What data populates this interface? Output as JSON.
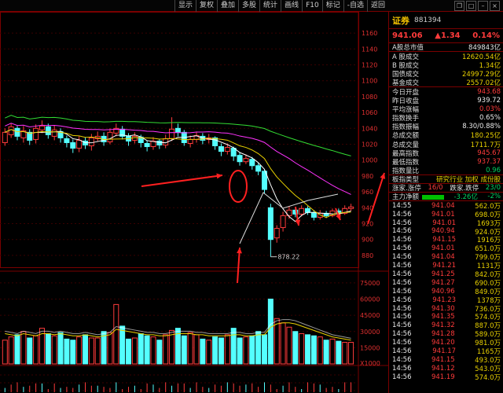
{
  "toolbar": [
    "显示",
    "复权",
    "叠加",
    "多股",
    "统计",
    "画线",
    "F10",
    "标记",
    "-自选",
    "返回"
  ],
  "window_controls": [
    "icon-r",
    "icon-max",
    "icon-min",
    "icon-x"
  ],
  "colors": {
    "up": "#ff3b3b",
    "down": "#54ffff",
    "ma1": "#ffffff",
    "ma2": "#e8d000",
    "ma3": "#ff33ff",
    "ma4": "#33dd33",
    "grid": "#7a0000"
  },
  "chart_data": {
    "type": "candlestick",
    "price_ticks": [
      "1160",
      "1140",
      "1120",
      "1100",
      "1080",
      "1060",
      "1040",
      "1020",
      "1000",
      "980",
      "960",
      "940",
      "920",
      "900",
      "880"
    ],
    "price_range": [
      870,
      1170
    ],
    "low_label": "878.22",
    "volume_ticks": [
      "75000",
      "60000",
      "45000",
      "30000",
      "15000",
      "X1000"
    ],
    "volume_range": [
      0,
      80000
    ],
    "candles": [
      {
        "o": 1022,
        "c": 1035,
        "h": 1040,
        "l": 1018
      },
      {
        "o": 1032,
        "c": 1042,
        "h": 1046,
        "l": 1028
      },
      {
        "o": 1040,
        "c": 1030,
        "h": 1043,
        "l": 1025
      },
      {
        "o": 1028,
        "c": 1037,
        "h": 1043,
        "l": 1022
      },
      {
        "o": 1035,
        "c": 1025,
        "h": 1039,
        "l": 1019
      },
      {
        "o": 1026,
        "c": 1040,
        "h": 1045,
        "l": 1021
      },
      {
        "o": 1038,
        "c": 1043,
        "h": 1050,
        "l": 1034
      },
      {
        "o": 1042,
        "c": 1032,
        "h": 1046,
        "l": 1027
      },
      {
        "o": 1030,
        "c": 1038,
        "h": 1044,
        "l": 1025
      },
      {
        "o": 1036,
        "c": 1028,
        "h": 1040,
        "l": 1022
      },
      {
        "o": 1027,
        "c": 1022,
        "h": 1031,
        "l": 1016
      },
      {
        "o": 1022,
        "c": 1015,
        "h": 1026,
        "l": 1009
      },
      {
        "o": 1015,
        "c": 1025,
        "h": 1030,
        "l": 1010
      },
      {
        "o": 1024,
        "c": 1019,
        "h": 1029,
        "l": 1014
      },
      {
        "o": 1018,
        "c": 1028,
        "h": 1033,
        "l": 1012
      },
      {
        "o": 1027,
        "c": 1030,
        "h": 1036,
        "l": 1023
      },
      {
        "o": 1030,
        "c": 1023,
        "h": 1035,
        "l": 1018
      },
      {
        "o": 1023,
        "c": 1035,
        "h": 1040,
        "l": 1020
      },
      {
        "o": 1034,
        "c": 1040,
        "h": 1046,
        "l": 1030
      },
      {
        "o": 1039,
        "c": 1030,
        "h": 1043,
        "l": 1026
      },
      {
        "o": 1030,
        "c": 1024,
        "h": 1034,
        "l": 1018
      },
      {
        "o": 1025,
        "c": 1030,
        "h": 1035,
        "l": 1021
      },
      {
        "o": 1029,
        "c": 1022,
        "h": 1032,
        "l": 1016
      },
      {
        "o": 1021,
        "c": 1017,
        "h": 1025,
        "l": 1011
      },
      {
        "o": 1017,
        "c": 1024,
        "h": 1029,
        "l": 1013
      },
      {
        "o": 1024,
        "c": 1019,
        "h": 1027,
        "l": 1014
      },
      {
        "o": 1019,
        "c": 1027,
        "h": 1032,
        "l": 1015
      },
      {
        "o": 1027,
        "c": 1039,
        "h": 1054,
        "l": 1024
      },
      {
        "o": 1040,
        "c": 1035,
        "h": 1046,
        "l": 1030
      },
      {
        "o": 1035,
        "c": 1022,
        "h": 1038,
        "l": 1018
      },
      {
        "o": 1021,
        "c": 1026,
        "h": 1031,
        "l": 1016
      },
      {
        "o": 1026,
        "c": 1031,
        "h": 1036,
        "l": 1022
      },
      {
        "o": 1030,
        "c": 1025,
        "h": 1034,
        "l": 1020
      },
      {
        "o": 1026,
        "c": 1028,
        "h": 1033,
        "l": 1021
      },
      {
        "o": 1028,
        "c": 1018,
        "h": 1030,
        "l": 1013
      },
      {
        "o": 1017,
        "c": 1011,
        "h": 1021,
        "l": 1005
      },
      {
        "o": 1011,
        "c": 1016,
        "h": 1021,
        "l": 1007
      },
      {
        "o": 1015,
        "c": 1005,
        "h": 1017,
        "l": 999
      },
      {
        "o": 1006,
        "c": 998,
        "h": 1010,
        "l": 993
      },
      {
        "o": 998,
        "c": 1002,
        "h": 1007,
        "l": 995
      },
      {
        "o": 1001,
        "c": 993,
        "h": 1004,
        "l": 988
      },
      {
        "o": 993,
        "c": 986,
        "h": 996,
        "l": 981
      },
      {
        "o": 986,
        "c": 963,
        "h": 988,
        "l": 958
      },
      {
        "o": 940,
        "c": 900,
        "h": 945,
        "l": 878.22
      },
      {
        "o": 902,
        "c": 914,
        "h": 918,
        "l": 896
      },
      {
        "o": 915,
        "c": 930,
        "h": 935,
        "l": 910
      },
      {
        "o": 930,
        "c": 937,
        "h": 942,
        "l": 926
      },
      {
        "o": 937,
        "c": 932,
        "h": 941,
        "l": 928
      },
      {
        "o": 932,
        "c": 939,
        "h": 943,
        "l": 929
      },
      {
        "o": 939,
        "c": 934,
        "h": 942,
        "l": 931
      },
      {
        "o": 934,
        "c": 928,
        "h": 937,
        "l": 924
      },
      {
        "o": 928,
        "c": 933,
        "h": 937,
        "l": 925
      },
      {
        "o": 933,
        "c": 930,
        "h": 936,
        "l": 927
      },
      {
        "o": 930,
        "c": 936,
        "h": 939,
        "l": 928
      },
      {
        "o": 936,
        "c": 933,
        "h": 939,
        "l": 930
      },
      {
        "o": 933,
        "c": 939,
        "h": 943,
        "l": 931
      },
      {
        "o": 939,
        "c": 941,
        "h": 945,
        "l": 936
      }
    ],
    "volumes": [
      22000,
      25000,
      27000,
      30000,
      24000,
      26000,
      33000,
      28000,
      26000,
      29000,
      23000,
      22000,
      25000,
      27000,
      24000,
      24000,
      30000,
      29000,
      55000,
      35000,
      23000,
      24000,
      28000,
      26000,
      25000,
      22000,
      27000,
      31000,
      33000,
      26000,
      29000,
      27000,
      23000,
      22000,
      25000,
      24000,
      27000,
      33000,
      24000,
      25000,
      26000,
      30000,
      27000,
      60000,
      42000,
      38000,
      34000,
      30000,
      28000,
      27000,
      26000,
      25000,
      22000,
      23000,
      21000,
      20000,
      20000
    ],
    "ma_volume": [
      28000,
      27000,
      26000,
      28000,
      27000,
      26000,
      28000,
      28000,
      27000,
      28000,
      27000,
      26000,
      26000,
      27000,
      26000,
      25000,
      26000,
      27000,
      32000,
      31000,
      30000,
      29000,
      28000,
      27000,
      27000,
      26000,
      26000,
      27000,
      28000,
      28000,
      28000,
      27000,
      27000,
      26000,
      26000,
      26000,
      26000,
      27000,
      27000,
      26000,
      26000,
      27000,
      27000,
      34000,
      37000,
      38000,
      38000,
      37000,
      35000,
      33000,
      31000,
      29000,
      27000,
      25000,
      24000,
      23000,
      22000
    ],
    "annotations": [
      {
        "type": "arrow"
      },
      {
        "type": "arrow"
      },
      {
        "type": "arrow"
      },
      {
        "type": "arrow"
      },
      {
        "type": "arrow"
      },
      {
        "type": "ellipse"
      }
    ]
  },
  "panel": {
    "name": "证券",
    "code": "881394",
    "price": "941.06",
    "change": "▲1.34",
    "pct": "0.14%",
    "stats": [
      {
        "l": "A股总市值",
        "v": "849843亿",
        "c": "white"
      },
      {
        "l": "A 股成交",
        "v": "12620.54亿",
        "c": "yellow"
      },
      {
        "l": "B 股成交",
        "v": "1.34亿",
        "c": "yellow"
      },
      {
        "l": "国债成交",
        "v": "24997.29亿",
        "c": "yellow"
      },
      {
        "l": "基金成交",
        "v": "2557.02亿",
        "c": "yellow"
      },
      {
        "l": "今日开盘",
        "v": "943.68",
        "c": "red"
      },
      {
        "l": "昨日收盘",
        "v": "939.72",
        "c": "white"
      },
      {
        "l": "平均涨幅",
        "v": "0.03%",
        "c": "red"
      },
      {
        "l": "指数换手",
        "v": "0.65%",
        "c": "white"
      },
      {
        "l": "指数振幅",
        "v": "8.30/0.88%",
        "c": "white"
      },
      {
        "l": "总成交额",
        "v": "180.25亿",
        "c": "yellow"
      },
      {
        "l": "总成交量",
        "v": "1711.7万",
        "c": "yellow"
      },
      {
        "l": "最高指数",
        "v": "945.67",
        "c": "red"
      },
      {
        "l": "最低指数",
        "v": "937.37",
        "c": "red"
      },
      {
        "l": "指数量比",
        "v": "0.96",
        "c": "green"
      }
    ],
    "bankuai": {
      "l": "板指类型",
      "v": "研究行业 加权 成份股"
    },
    "zdt": {
      "l": "涨家.涨停",
      "v1": "16/0",
      "m": "跌家.跌停",
      "v2": "23/0"
    },
    "zl": {
      "l": "主力净额",
      "v": "-3.26亿",
      "p": "-2%"
    },
    "trades": [
      {
        "t": "14:55",
        "p": "941.04",
        "v": "562.0万"
      },
      {
        "t": "14:56",
        "p": "941.01",
        "v": "698.0万"
      },
      {
        "t": "14:56",
        "p": "941.01",
        "v": "1693万"
      },
      {
        "t": "14:56",
        "p": "940.94",
        "v": "924.0万"
      },
      {
        "t": "14:56",
        "p": "941.15",
        "v": "1916万"
      },
      {
        "t": "14:56",
        "p": "941.01",
        "v": "651.0万"
      },
      {
        "t": "14:56",
        "p": "941.04",
        "v": "799.0万"
      },
      {
        "t": "14:56",
        "p": "941.21",
        "v": "1131万"
      },
      {
        "t": "14:56",
        "p": "941.25",
        "v": "842.0万"
      },
      {
        "t": "14:56",
        "p": "941.27",
        "v": "690.0万"
      },
      {
        "t": "14:56",
        "p": "940.96",
        "v": "849.0万"
      },
      {
        "t": "14:56",
        "p": "941.23",
        "v": "1378万"
      },
      {
        "t": "14:56",
        "p": "941.30",
        "v": "736.0万"
      },
      {
        "t": "14:56",
        "p": "941.35",
        "v": "574.0万"
      },
      {
        "t": "14:56",
        "p": "941.32",
        "v": "887.0万"
      },
      {
        "t": "14:56",
        "p": "941.28",
        "v": "589.0万"
      },
      {
        "t": "14:56",
        "p": "941.20",
        "v": "981.0万"
      },
      {
        "t": "14:56",
        "p": "941.17",
        "v": "1165万"
      },
      {
        "t": "14:56",
        "p": "941.15",
        "v": "493.0万"
      },
      {
        "t": "14:56",
        "p": "941.12",
        "v": "543.0万"
      },
      {
        "t": "14:56",
        "p": "941.19",
        "v": "574.0万"
      }
    ]
  }
}
